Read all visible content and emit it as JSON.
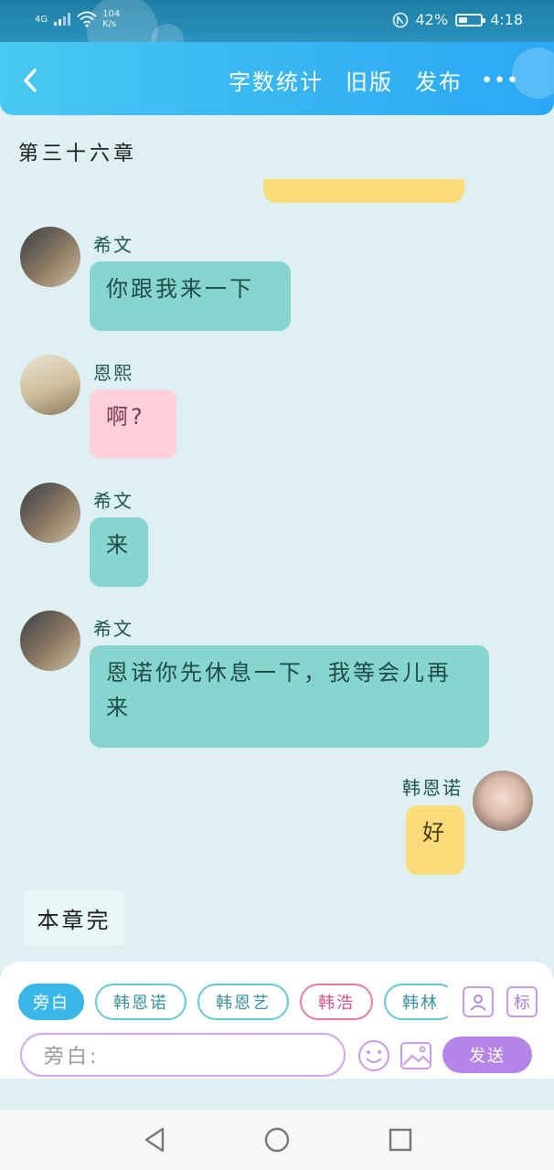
{
  "status_bar": {
    "network": "4G",
    "speed_value": "104",
    "speed_unit": "K/s",
    "battery_percent": "42%",
    "battery_level": 0.42,
    "time": "4:18"
  },
  "header": {
    "word_count_label": "字数统计",
    "old_version_label": "旧版",
    "publish_label": "发布",
    "more_label": "•••"
  },
  "chapter": {
    "title": "第三十六章",
    "end_label": "本章完"
  },
  "messages": [
    {
      "speaker": "希文",
      "text": "你跟我来一下",
      "style": "teal",
      "side": "left"
    },
    {
      "speaker": "恩熙",
      "text": "啊?",
      "style": "pink",
      "side": "left"
    },
    {
      "speaker": "希文",
      "text": "来",
      "style": "teal",
      "side": "left"
    },
    {
      "speaker": "希文",
      "text": "恩诺你先休息一下，我等会儿再来",
      "style": "teal",
      "side": "left"
    },
    {
      "speaker": "韩恩诺",
      "text": "好",
      "style": "yellow",
      "side": "right"
    }
  ],
  "input_panel": {
    "chips": [
      "旁白",
      "韩恩诺",
      "韩恩艺",
      "韩浩",
      "韩林"
    ],
    "placeholder": "旁白:",
    "send_label": "发送",
    "tag_label": "标"
  },
  "colors": {
    "header_start": "#49c9f0",
    "header_end": "#2aa8f4",
    "teal_bubble": "#86d5cf",
    "pink_bubble": "#ffcfdc",
    "yellow_bubble": "#fbdc7a",
    "send_button": "#b685e8"
  }
}
